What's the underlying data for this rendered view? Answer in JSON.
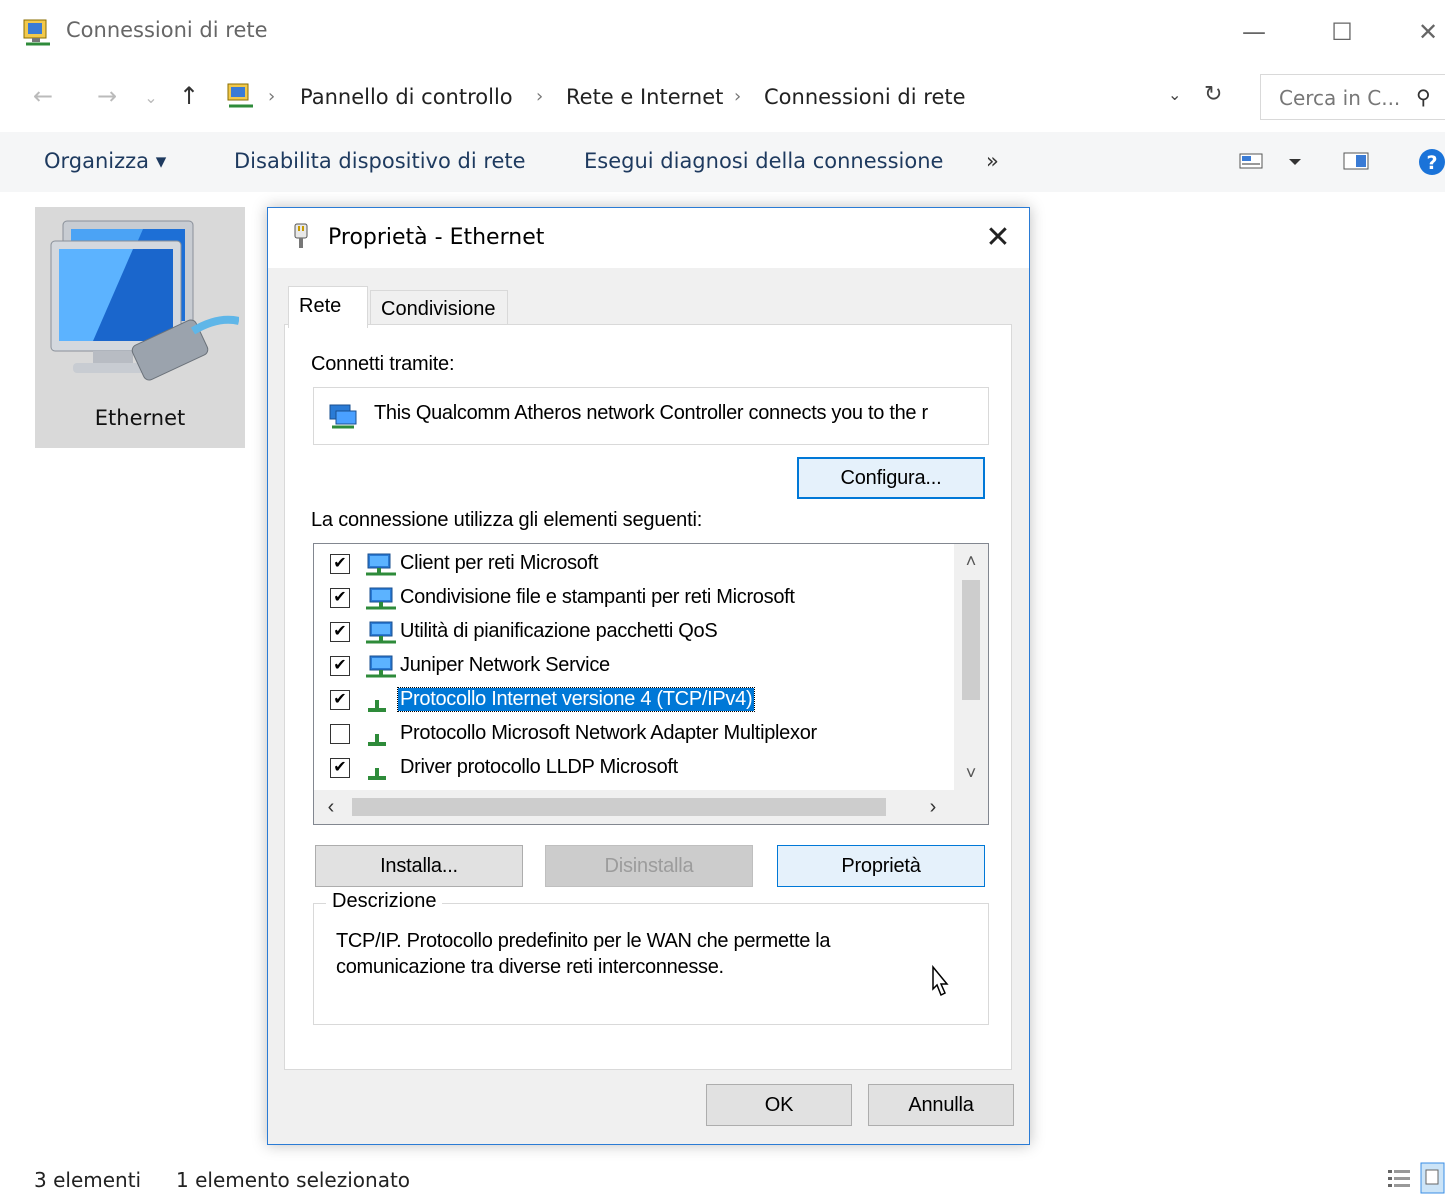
{
  "window": {
    "title": "Connessioni di rete",
    "controls": {
      "minimize": "—",
      "maximize": "☐",
      "close": "✕"
    }
  },
  "navigation": {
    "back": "←",
    "forward": "→",
    "recent": "⌄",
    "up": "↑",
    "breadcrumb": [
      "Pannello di controllo",
      "Rete e Internet",
      "Connessioni di rete"
    ],
    "separator": "›",
    "dropdown": "⌄",
    "refresh": "↻",
    "search_placeholder": "Cerca in C...",
    "search_icon": "⚲"
  },
  "command_bar": {
    "organize": "Organizza ▾",
    "disable_device": "Disabilita dispositivo di rete",
    "diagnose": "Esegui diagnosi della connessione",
    "more": "»"
  },
  "items": [
    {
      "name": "Ethernet",
      "selected": true
    }
  ],
  "status_bar": {
    "count": "3 elementi",
    "selected": "1 elemento selezionato"
  },
  "dialog": {
    "title": "Proprietà - Ethernet",
    "close": "✕",
    "tabs": [
      {
        "label": "Rete",
        "active": true
      },
      {
        "label": "Condivisione",
        "active": false
      }
    ],
    "connect_using_label": "Connetti tramite:",
    "adapter_text": "This Qualcomm Atheros network Controller connects you to the r",
    "configure_button": "Configura...",
    "components_label": "La connessione utilizza gli elementi seguenti:",
    "components": [
      {
        "label": "Client per reti Microsoft",
        "checked": true,
        "icon": "network-client-icon",
        "selected": false
      },
      {
        "label": "Condivisione file e stampanti per reti Microsoft",
        "checked": true,
        "icon": "network-service-icon",
        "selected": false
      },
      {
        "label": "Utilità di pianificazione pacchetti QoS",
        "checked": true,
        "icon": "network-service-icon",
        "selected": false
      },
      {
        "label": "Juniper Network Service",
        "checked": true,
        "icon": "network-service-icon",
        "selected": false
      },
      {
        "label": "Protocollo Internet versione 4 (TCP/IPv4)",
        "checked": true,
        "icon": "protocol-icon",
        "selected": true
      },
      {
        "label": "Protocollo Microsoft Network Adapter Multiplexor",
        "checked": false,
        "icon": "protocol-icon",
        "selected": false
      },
      {
        "label": "Driver protocollo LLDP Microsoft",
        "checked": true,
        "icon": "protocol-icon",
        "selected": false
      }
    ],
    "scroll": {
      "up": "˄",
      "down": "˅",
      "left": "‹",
      "right": "›"
    },
    "install_button": "Installa...",
    "uninstall_button": "Disinstalla",
    "properties_button": "Proprietà",
    "description_title": "Descrizione",
    "description_text": "TCP/IP. Protocollo predefinito per le WAN che permette la comunicazione tra diverse reti interconnesse.",
    "ok_button": "OK",
    "cancel_button": "Annulla"
  },
  "colors": {
    "selection": "#0078d7",
    "dialog_border": "#2a7bd5",
    "item_selected_bg": "#d9d9d9",
    "link_text": "#1e3a5f"
  }
}
